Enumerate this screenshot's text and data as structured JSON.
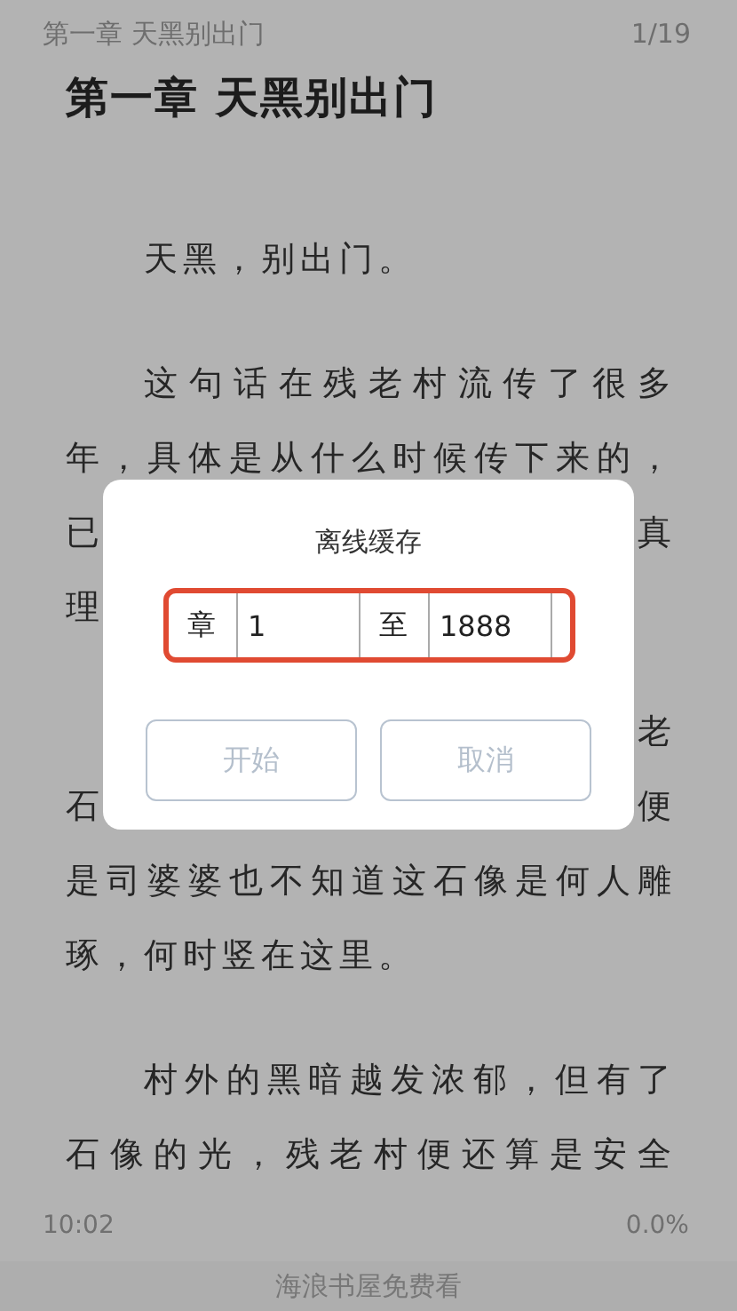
{
  "header": {
    "chapter": "第一章 天黑别出门",
    "page": "1/19"
  },
  "title": "第一章 天黑别出门",
  "lines": [
    {
      "left": "天黑，别出门。",
      "indent": true,
      "full": false
    },
    {
      "left": "这句话在残老村流传了很多",
      "indent": true,
      "full": true
    },
    {
      "left": "年，具体是从什么时候传下来的，",
      "indent": false,
      "full": true
    },
    {
      "left": "已",
      "right": "真",
      "indent": false,
      "full": true
    },
    {
      "left": "理",
      "indent": false
    },
    {
      "right": "老",
      "indent": true,
      "full": true
    },
    {
      "left": "石",
      "right": "便",
      "indent": false,
      "full": true
    },
    {
      "left": "是司婆婆也不知道这石像是何人雕",
      "indent": false,
      "full": true
    },
    {
      "left": "琢，何时竖在这里。",
      "indent": false,
      "full": false
    },
    {
      "left": "村外的黑暗越发浓郁，但有了",
      "indent": true,
      "full": true
    },
    {
      "left": "石像的光，残老村便还算是安全",
      "indent": false,
      "full": true
    }
  ],
  "dialog": {
    "title": "离线缓存",
    "from_label": "章",
    "from_value": "1",
    "to_label": "至",
    "to_value": "1888",
    "highlighted": true,
    "buttons": [
      {
        "label": "开始",
        "disabled": true
      },
      {
        "label": "取消",
        "disabled": true
      }
    ]
  },
  "footer": {
    "time": "10:02",
    "progress": "0.0%"
  },
  "banner": "海浪书屋免费看"
}
